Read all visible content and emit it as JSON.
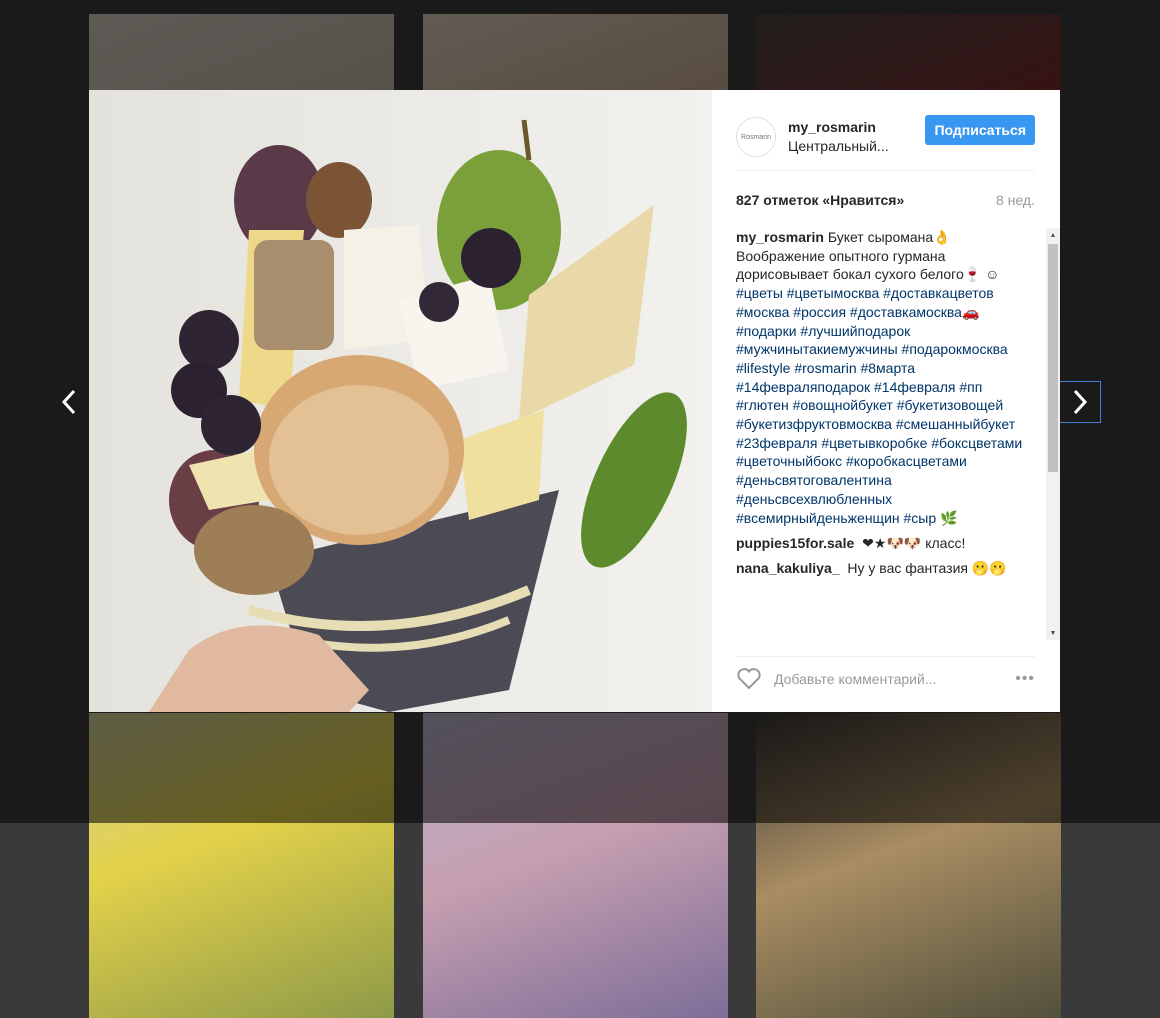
{
  "post": {
    "username": "my_rosmarin",
    "avatar_text": "Rosmarin",
    "location": "Центральный...",
    "follow_label": "Подписаться",
    "likes": "827 отметок «Нравится»",
    "age": "8 нед.",
    "caption_user": "my_rosmarin",
    "caption_text": "Букет сыромана👌 Воображение опытного гурмана дорисовывает бокал сухого белого🍷 ☺",
    "caption_tags": "#цветы #цветымосква #доставкацветов #москва #россия #доставкамосква🚗 #подарки #лучшийподарок #мужчинытакиемужчины #подарокмосква #lifestyle #rosmarin #8марта #14февраляподарок #14февраля #пп #глютен #овощнойбукет #букетизовощей #букетизфруктовмосква #смешанныйбукет #23февраля #цветывкоробке #боксцветами #цветочныйбокс #коробкасцветами #деньсвятоговалентина #деньсвсехвлюбленных #всемирныйденьженщин #сыр 🌿",
    "comments": [
      {
        "user": "puppies15for.sale",
        "text": "❤★🐶🐶 класс!"
      },
      {
        "user": "nana_kakuliya_",
        "text": "Ну у вас фантазия 🫢🫢"
      }
    ],
    "comment_placeholder": "Добавьте комментарий...",
    "more_label": "•••"
  },
  "icons": {
    "prev": "chevron-left-icon",
    "next": "chevron-right-icon",
    "like": "heart-icon",
    "more": "more-options-icon"
  },
  "colors": {
    "follow_button": "#3897f0",
    "hashtag": "#003569",
    "backdrop": "#3a3a3a"
  }
}
